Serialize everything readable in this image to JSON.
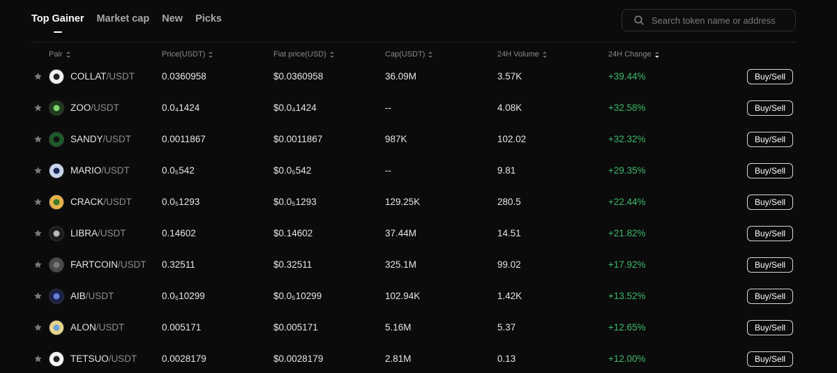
{
  "tabs": [
    {
      "label": "Top Gainer",
      "active": true
    },
    {
      "label": "Market cap",
      "active": false
    },
    {
      "label": "New",
      "active": false
    },
    {
      "label": "Picks",
      "active": false
    }
  ],
  "search": {
    "placeholder": "Search token name or address",
    "value": ""
  },
  "columns": {
    "pair": "Pair",
    "price": "Price(USDT)",
    "fiat": "Fiat price(USD)",
    "cap": "Cap(USDT)",
    "volume": "24H Volume",
    "change": "24H Change"
  },
  "colors": {
    "positive": "#3fb96b",
    "background": "#0b0b0b"
  },
  "rows": [
    {
      "base": "COLLAT",
      "quote": "/USDT",
      "price": "0.0360958",
      "fiat": "$0.0360958",
      "cap": "36.09M",
      "volume": "3.57K",
      "change": "+39.44%",
      "action": "Buy/Sell",
      "icon": "collat-token-icon"
    },
    {
      "base": "ZOO",
      "quote": "/USDT",
      "price": "0.0₄1424",
      "fiat": "$0.0₄1424",
      "cap": "--",
      "volume": "4.08K",
      "change": "+32.58%",
      "action": "Buy/Sell",
      "icon": "zoo-token-icon"
    },
    {
      "base": "SANDY",
      "quote": "/USDT",
      "price": "0.0011867",
      "fiat": "$0.0011867",
      "cap": "987K",
      "volume": "102.02",
      "change": "+32.32%",
      "action": "Buy/Sell",
      "icon": "sandy-token-icon"
    },
    {
      "base": "MARIO",
      "quote": "/USDT",
      "price": "0.0₅542",
      "fiat": "$0.0₅542",
      "cap": "--",
      "volume": "9.81",
      "change": "+29.35%",
      "action": "Buy/Sell",
      "icon": "mario-token-icon"
    },
    {
      "base": "CRACK",
      "quote": "/USDT",
      "price": "0.0₅1293",
      "fiat": "$0.0₅1293",
      "cap": "129.25K",
      "volume": "280.5",
      "change": "+22.44%",
      "action": "Buy/Sell",
      "icon": "crack-token-icon"
    },
    {
      "base": "LIBRA",
      "quote": "/USDT",
      "price": "0.14602",
      "fiat": "$0.14602",
      "cap": "37.44M",
      "volume": "14.51",
      "change": "+21.82%",
      "action": "Buy/Sell",
      "icon": "libra-token-icon"
    },
    {
      "base": "FARTCOIN",
      "quote": "/USDT",
      "price": "0.32511",
      "fiat": "$0.32511",
      "cap": "325.1M",
      "volume": "99.02",
      "change": "+17.92%",
      "action": "Buy/Sell",
      "icon": "fartcoin-token-icon"
    },
    {
      "base": "AIB",
      "quote": "/USDT",
      "price": "0.0₅10299",
      "fiat": "$0.0₅10299",
      "cap": "102.94K",
      "volume": "1.42K",
      "change": "+13.52%",
      "action": "Buy/Sell",
      "icon": "aib-token-icon"
    },
    {
      "base": "ALON",
      "quote": "/USDT",
      "price": "0.005171",
      "fiat": "$0.005171",
      "cap": "5.16M",
      "volume": "5.37",
      "change": "+12.65%",
      "action": "Buy/Sell",
      "icon": "alon-token-icon"
    },
    {
      "base": "TETSUO",
      "quote": "/USDT",
      "price": "0.0028179",
      "fiat": "$0.0028179",
      "cap": "2.81M",
      "volume": "0.13",
      "change": "+12.00%",
      "action": "Buy/Sell",
      "icon": "tetsuo-token-icon"
    }
  ]
}
